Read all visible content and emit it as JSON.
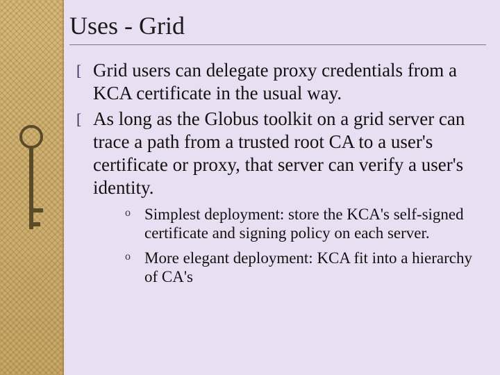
{
  "title": "Uses - Grid",
  "bullets": [
    "Grid users can delegate proxy credentials from a KCA certificate in the usual way.",
    "As long as the Globus toolkit on a grid server can trace a path from a trusted root CA to a user's certificate or proxy, that server can verify a user's identity."
  ],
  "sub_bullets": [
    "Simplest deployment: store the KCA's self-signed certificate and signing policy on each server.",
    "More elegant deployment: KCA fit into a hierarchy of CA's"
  ],
  "bullet_glyph": "[",
  "sub_bullet_glyph": "o"
}
